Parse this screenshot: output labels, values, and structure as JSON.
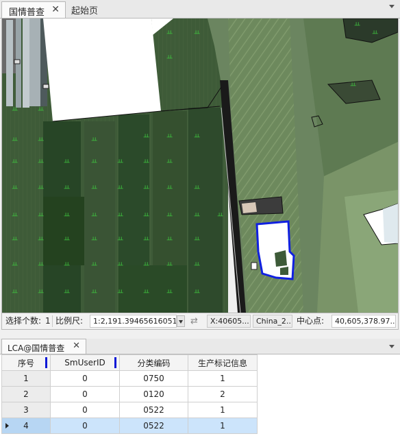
{
  "tabs": {
    "active_label": "国情普查",
    "close_glyph": "✕",
    "inactive_label": "起始页"
  },
  "statusbar": {
    "select_count_label": "选择个数:",
    "select_count_value": "1",
    "scale_label": "比例尺:",
    "scale_value": "1:2,191.39465616051",
    "swap_glyph": "⇄",
    "x_coord": "X:40605...",
    "crs": "China_2...",
    "center_label": "中心点:",
    "center_value": "40,605,378.97..."
  },
  "panel": {
    "tab_label": "LCA@国情普查",
    "close_glyph": "✕"
  },
  "table": {
    "columns": [
      "序号",
      "SmUserID",
      "分类编码",
      "生产标记信息"
    ],
    "rows": [
      [
        "1",
        "0",
        "0750",
        "1"
      ],
      [
        "2",
        "0",
        "0120",
        "2"
      ],
      [
        "3",
        "0",
        "0522",
        "1"
      ],
      [
        "4",
        "0",
        "0522",
        "1"
      ]
    ],
    "selected_row": 4
  },
  "map": {
    "field_symbol": "ㅛ"
  },
  "colors": {
    "selection_outline": "#1020e0",
    "header_marker": "#0a18d6",
    "selected_row": "#cce4fb"
  },
  "icons": [
    "close-icon",
    "dropdown-arrow-icon",
    "swap-icon",
    "row-pointer-icon",
    "menu-arrow-icon"
  ]
}
